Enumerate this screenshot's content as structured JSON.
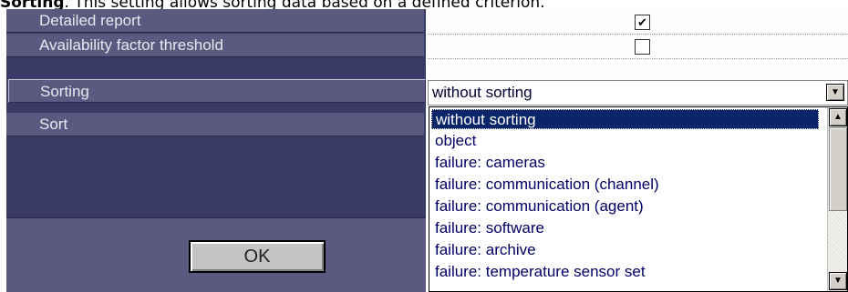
{
  "caption": {
    "bold": "Sorting",
    "text": ". This setting allows sorting data based on a defined criterion."
  },
  "rows": {
    "detailed_report": {
      "label": "Detailed report",
      "checked": true
    },
    "availability_factor_threshold": {
      "label": "Availability factor threshold",
      "checked": false
    },
    "sorting": {
      "label": "Sorting",
      "value": "without sorting"
    },
    "sort": {
      "label": "Sort"
    }
  },
  "ok_button": {
    "label": "OK"
  },
  "icons": {
    "checkmark": "✔",
    "dropdown_arrow": "▼",
    "scroll_up": "▲",
    "scroll_down": "▼"
  },
  "dropdown": {
    "options": [
      "without sorting",
      "object",
      "failure: cameras",
      "failure: communication (channel)",
      "failure: communication (agent)",
      "failure: software",
      "failure: archive",
      "failure: temperature sensor set"
    ],
    "selected_index": 0
  }
}
